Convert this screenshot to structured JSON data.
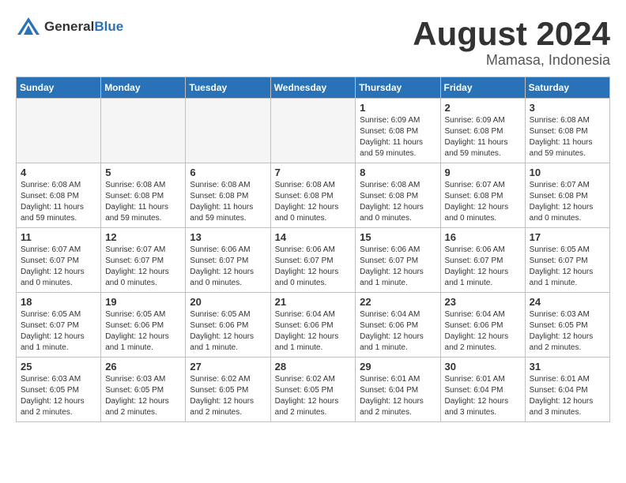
{
  "header": {
    "logo_general": "General",
    "logo_blue": "Blue",
    "month_title": "August 2024",
    "location": "Mamasa, Indonesia"
  },
  "calendar": {
    "day_headers": [
      "Sunday",
      "Monday",
      "Tuesday",
      "Wednesday",
      "Thursday",
      "Friday",
      "Saturday"
    ],
    "weeks": [
      [
        {
          "day": "",
          "info": "",
          "empty": true
        },
        {
          "day": "",
          "info": "",
          "empty": true
        },
        {
          "day": "",
          "info": "",
          "empty": true
        },
        {
          "day": "",
          "info": "",
          "empty": true
        },
        {
          "day": "1",
          "info": "Sunrise: 6:09 AM\nSunset: 6:08 PM\nDaylight: 11 hours and 59 minutes."
        },
        {
          "day": "2",
          "info": "Sunrise: 6:09 AM\nSunset: 6:08 PM\nDaylight: 11 hours and 59 minutes."
        },
        {
          "day": "3",
          "info": "Sunrise: 6:08 AM\nSunset: 6:08 PM\nDaylight: 11 hours and 59 minutes."
        }
      ],
      [
        {
          "day": "4",
          "info": "Sunrise: 6:08 AM\nSunset: 6:08 PM\nDaylight: 11 hours and 59 minutes."
        },
        {
          "day": "5",
          "info": "Sunrise: 6:08 AM\nSunset: 6:08 PM\nDaylight: 11 hours and 59 minutes."
        },
        {
          "day": "6",
          "info": "Sunrise: 6:08 AM\nSunset: 6:08 PM\nDaylight: 11 hours and 59 minutes."
        },
        {
          "day": "7",
          "info": "Sunrise: 6:08 AM\nSunset: 6:08 PM\nDaylight: 12 hours and 0 minutes."
        },
        {
          "day": "8",
          "info": "Sunrise: 6:08 AM\nSunset: 6:08 PM\nDaylight: 12 hours and 0 minutes."
        },
        {
          "day": "9",
          "info": "Sunrise: 6:07 AM\nSunset: 6:08 PM\nDaylight: 12 hours and 0 minutes."
        },
        {
          "day": "10",
          "info": "Sunrise: 6:07 AM\nSunset: 6:08 PM\nDaylight: 12 hours and 0 minutes."
        }
      ],
      [
        {
          "day": "11",
          "info": "Sunrise: 6:07 AM\nSunset: 6:07 PM\nDaylight: 12 hours and 0 minutes."
        },
        {
          "day": "12",
          "info": "Sunrise: 6:07 AM\nSunset: 6:07 PM\nDaylight: 12 hours and 0 minutes."
        },
        {
          "day": "13",
          "info": "Sunrise: 6:06 AM\nSunset: 6:07 PM\nDaylight: 12 hours and 0 minutes."
        },
        {
          "day": "14",
          "info": "Sunrise: 6:06 AM\nSunset: 6:07 PM\nDaylight: 12 hours and 0 minutes."
        },
        {
          "day": "15",
          "info": "Sunrise: 6:06 AM\nSunset: 6:07 PM\nDaylight: 12 hours and 1 minute."
        },
        {
          "day": "16",
          "info": "Sunrise: 6:06 AM\nSunset: 6:07 PM\nDaylight: 12 hours and 1 minute."
        },
        {
          "day": "17",
          "info": "Sunrise: 6:05 AM\nSunset: 6:07 PM\nDaylight: 12 hours and 1 minute."
        }
      ],
      [
        {
          "day": "18",
          "info": "Sunrise: 6:05 AM\nSunset: 6:07 PM\nDaylight: 12 hours and 1 minute."
        },
        {
          "day": "19",
          "info": "Sunrise: 6:05 AM\nSunset: 6:06 PM\nDaylight: 12 hours and 1 minute."
        },
        {
          "day": "20",
          "info": "Sunrise: 6:05 AM\nSunset: 6:06 PM\nDaylight: 12 hours and 1 minute."
        },
        {
          "day": "21",
          "info": "Sunrise: 6:04 AM\nSunset: 6:06 PM\nDaylight: 12 hours and 1 minute."
        },
        {
          "day": "22",
          "info": "Sunrise: 6:04 AM\nSunset: 6:06 PM\nDaylight: 12 hours and 1 minute."
        },
        {
          "day": "23",
          "info": "Sunrise: 6:04 AM\nSunset: 6:06 PM\nDaylight: 12 hours and 2 minutes."
        },
        {
          "day": "24",
          "info": "Sunrise: 6:03 AM\nSunset: 6:05 PM\nDaylight: 12 hours and 2 minutes."
        }
      ],
      [
        {
          "day": "25",
          "info": "Sunrise: 6:03 AM\nSunset: 6:05 PM\nDaylight: 12 hours and 2 minutes."
        },
        {
          "day": "26",
          "info": "Sunrise: 6:03 AM\nSunset: 6:05 PM\nDaylight: 12 hours and 2 minutes."
        },
        {
          "day": "27",
          "info": "Sunrise: 6:02 AM\nSunset: 6:05 PM\nDaylight: 12 hours and 2 minutes."
        },
        {
          "day": "28",
          "info": "Sunrise: 6:02 AM\nSunset: 6:05 PM\nDaylight: 12 hours and 2 minutes."
        },
        {
          "day": "29",
          "info": "Sunrise: 6:01 AM\nSunset: 6:04 PM\nDaylight: 12 hours and 2 minutes."
        },
        {
          "day": "30",
          "info": "Sunrise: 6:01 AM\nSunset: 6:04 PM\nDaylight: 12 hours and 3 minutes."
        },
        {
          "day": "31",
          "info": "Sunrise: 6:01 AM\nSunset: 6:04 PM\nDaylight: 12 hours and 3 minutes."
        }
      ]
    ]
  }
}
